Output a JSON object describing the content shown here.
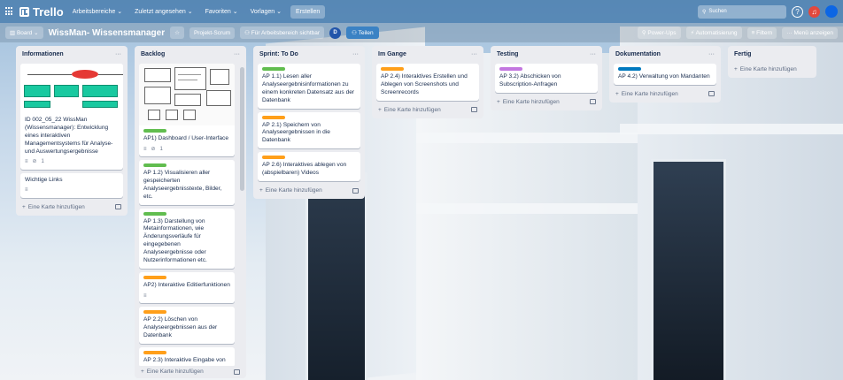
{
  "topbar": {
    "logo": "Trello",
    "menus": [
      "Arbeitsbereiche",
      "Zuletzt angesehen",
      "Favoriten",
      "Vorlagen"
    ],
    "create_label": "Erstellen",
    "search_placeholder": "Suchen"
  },
  "boardbar": {
    "view_label": "Board",
    "title": "WissMan- Wissensmanager",
    "workspace_label": "Projekt-Scrum",
    "visibility_label": "Für Arbeitsbereich sichtbar",
    "avatar_initial": "D",
    "share_label": "Teilen",
    "powerups_label": "Power-Ups",
    "automation_label": "Automatisierung",
    "filter_label": "Filtern",
    "menu_label": "Menü anzeigen"
  },
  "add_card_label": "Eine Karte hinzufügen",
  "lists": {
    "informationen": {
      "title": "Informationen",
      "cards": [
        {
          "text": "ID 002_05_22 WissMan (Wissensmanager): Entwicklung eines interaktiven Managementsystems für Analyse- und Auswertungsergebnisse",
          "attachments": "1"
        },
        {
          "text": "Wichtige Links"
        }
      ]
    },
    "backlog": {
      "title": "Backlog",
      "cards": [
        {
          "text": "AP1) Dashboard / User-Interface",
          "attachments": "1"
        },
        {
          "text": "AP 1.2) Visualisieren aller gespeicherten Analyseergebnisstexte, Bilder, etc."
        },
        {
          "text": "AP 1.3) Darstellung von Metainformationen, wie Änderungsverläufe für eingegebenen Analyseergebnisse oder Nutzerinformationen etc."
        },
        {
          "text": "AP2) Interaktive Editierfunktionen"
        },
        {
          "text": "AP 2.2) Löschen von Analyseergebnissen aus der Datenbank"
        },
        {
          "text": "AP 2.3) Interaktive Eingabe von"
        }
      ]
    },
    "sprint": {
      "title": "Sprint: To Do",
      "cards": [
        {
          "text": "AP 1.1) Lesen aller Analyseergebnisinformationen zu einem konkreten Datensatz aus der Datenbank"
        },
        {
          "text": "AP 2.1) Speichern von Analyseergebnissen in die Datenbank"
        },
        {
          "text": "AP 2.6) Interaktives ablegen von (abspielbaren) Videos"
        }
      ]
    },
    "im_gange": {
      "title": "Im Gange",
      "cards": [
        {
          "text": "AP 2.4) Interaktives Erstellen und Ablegen von Screenshots und Screenrecords"
        }
      ]
    },
    "testing": {
      "title": "Testing",
      "cards": [
        {
          "text": "AP 3.2) Abschicken von Subscription-Anfragen"
        }
      ]
    },
    "dokumentation": {
      "title": "Dokumentation",
      "cards": [
        {
          "text": "AP 4.2) Verwaltung von Mandanten"
        }
      ]
    },
    "fertig": {
      "title": "Fertig"
    }
  },
  "colors": {
    "green": "#61bd4f",
    "orange": "#ff9f1a",
    "purple": "#c377e0",
    "blue": "#0079bf"
  }
}
